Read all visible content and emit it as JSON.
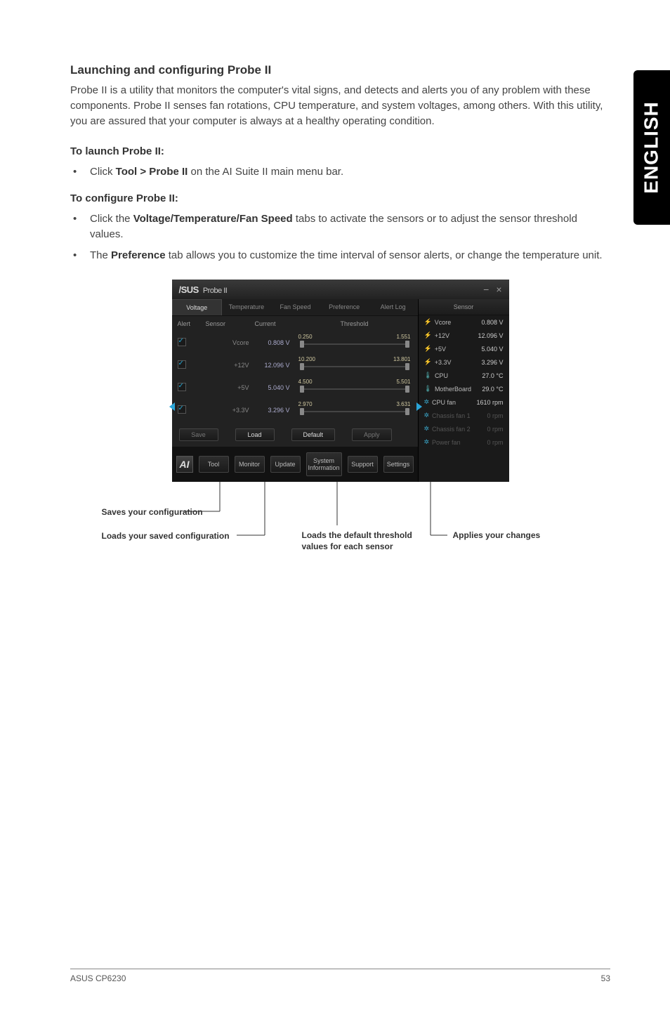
{
  "side_tab": "ENGLISH",
  "heading": "Launching and configuring Probe II",
  "intro": "Probe II is a utility that monitors the computer's vital signs, and detects and alerts you of any problem with these components. Probe II senses fan rotations, CPU temperature, and system voltages, among others. With this utility, you are assured that your computer is always at a healthy operating condition.",
  "launch_h": "To launch Probe II:",
  "launch_b_pre": "Click ",
  "launch_b_bold": "Tool > Probe II",
  "launch_b_post": " on the AI Suite II main menu bar.",
  "config_h": "To configure Probe II:",
  "config_b1_pre": "Click the ",
  "config_b1_bold": "Voltage/Temperature/Fan Speed",
  "config_b1_post": " tabs to activate the sensors or to adjust the sensor threshold values.",
  "config_b2_pre": "The ",
  "config_b2_bold": "Preference",
  "config_b2_post": " tab allows you to customize the time interval of sensor alerts, or change the temperature unit.",
  "probe": {
    "title_brand": "/SUS",
    "title_name": "Probe II",
    "tabs": [
      "Voltage",
      "Temperature",
      "Fan Speed",
      "Preference",
      "Alert Log"
    ],
    "cols": {
      "alert": "Alert",
      "sensor": "Sensor",
      "current": "Current",
      "threshold": "Threshold"
    },
    "rows": [
      {
        "name": "Vcore",
        "cur": "0.808 V",
        "lo": "0.250",
        "hi": "1.551"
      },
      {
        "name": "+12V",
        "cur": "12.096 V",
        "lo": "10.200",
        "hi": "13.801"
      },
      {
        "name": "+5V",
        "cur": "5.040 V",
        "lo": "4.500",
        "hi": "5.501"
      },
      {
        "name": "+3.3V",
        "cur": "3.296 V",
        "lo": "2.970",
        "hi": "3.631"
      }
    ],
    "actions": {
      "save": "Save",
      "load": "Load",
      "default": "Default",
      "apply": "Apply"
    },
    "bottom": [
      "Tool",
      "Monitor",
      "Update",
      "System Information",
      "Support",
      "Settings"
    ],
    "right_h": "Sensor",
    "right": [
      {
        "label": "Vcore",
        "val": "0.808 V",
        "type": "volt"
      },
      {
        "label": "+12V",
        "val": "12.096 V",
        "type": "volt"
      },
      {
        "label": "+5V",
        "val": "5.040 V",
        "type": "volt"
      },
      {
        "label": "+3.3V",
        "val": "3.296 V",
        "type": "volt"
      },
      {
        "label": "CPU",
        "val": "27.0 °C",
        "type": "temp"
      },
      {
        "label": "MotherBoard",
        "val": "29.0 °C",
        "type": "temp"
      },
      {
        "label": "CPU fan",
        "val": "1610 rpm",
        "type": "fan"
      },
      {
        "label": "Chassis fan 1",
        "val": "0 rpm",
        "type": "fan",
        "dim": true
      },
      {
        "label": "Chassis fan 2",
        "val": "0 rpm",
        "type": "fan",
        "dim": true
      },
      {
        "label": "Power fan",
        "val": "0 rpm",
        "type": "fan",
        "dim": true
      }
    ]
  },
  "callouts": {
    "saves": "Saves your configuration",
    "loads": "Loads your saved configuration",
    "default": "Loads the default threshold values for each sensor",
    "applies": "Applies your changes"
  },
  "footer_left": "ASUS CP6230",
  "footer_right": "53"
}
